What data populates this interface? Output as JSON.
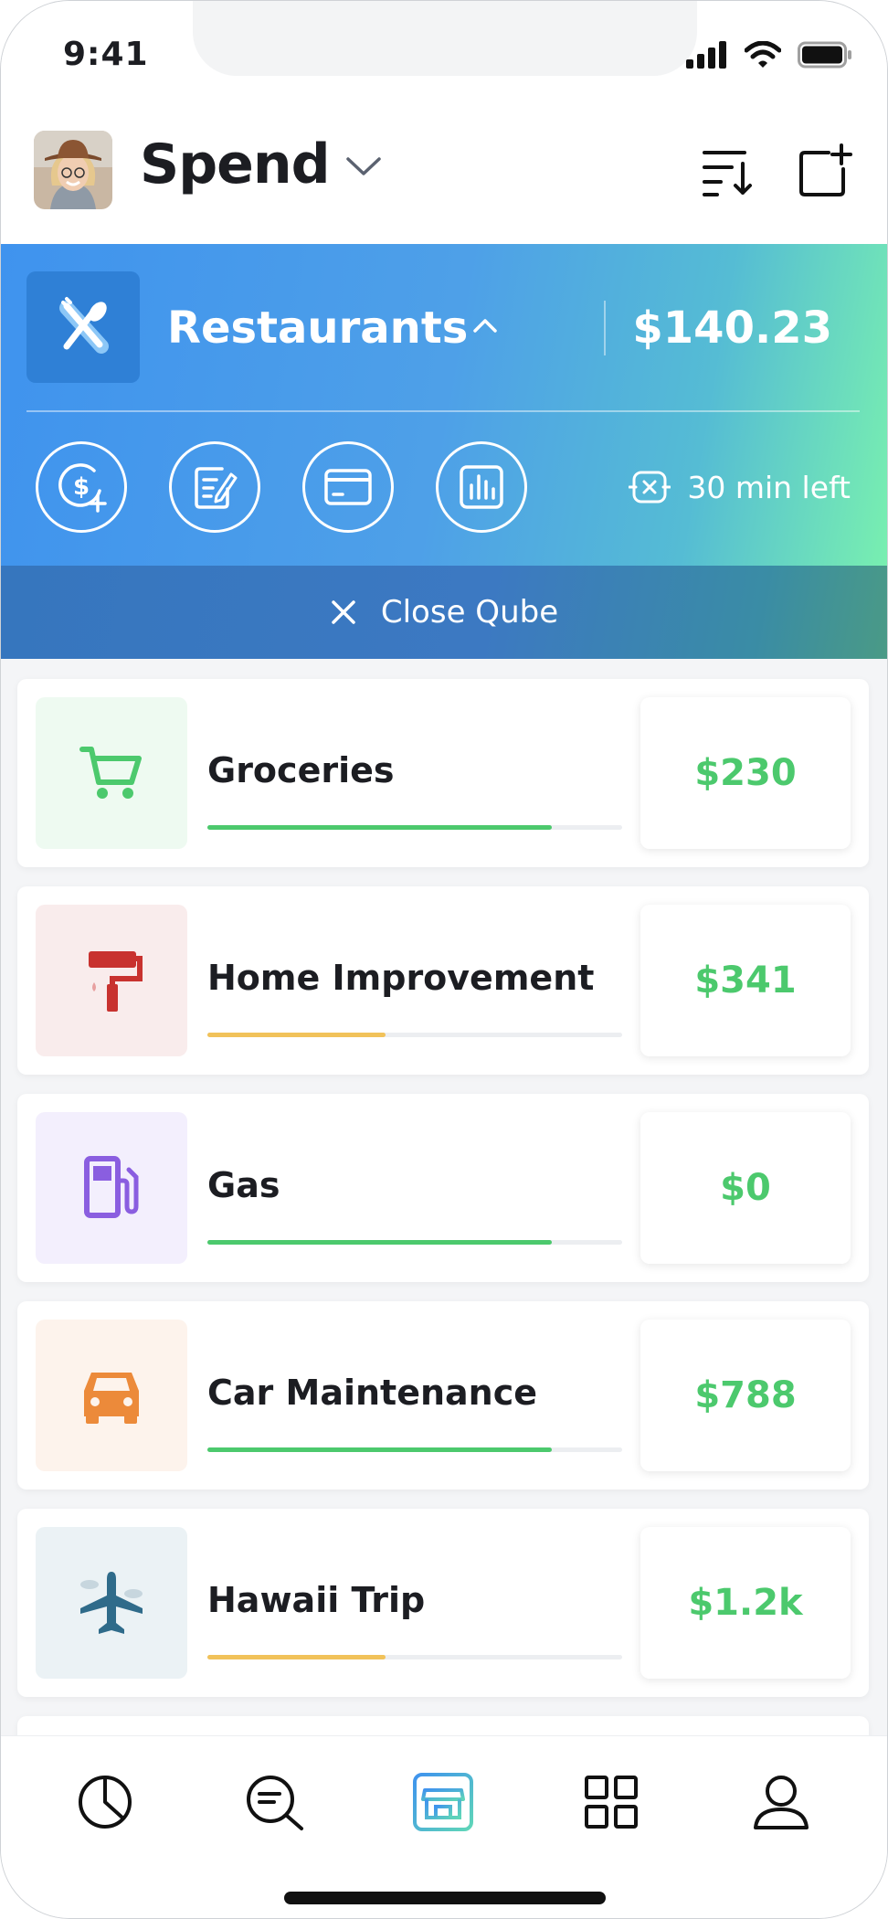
{
  "status_bar": {
    "time": "9:41"
  },
  "header": {
    "title": "Spend"
  },
  "qube": {
    "category": "Restaurants",
    "amount": "$140.23",
    "timer_text": "30 min left",
    "close_label": "Close Qube",
    "actions": [
      "add-funds-icon",
      "notes-icon",
      "card-icon",
      "report-icon"
    ]
  },
  "categories": [
    {
      "name": "Groceries",
      "amount": "$230",
      "progress": 0.83,
      "bar_color": "#4cc96d",
      "icon": "cart-icon",
      "icon_color": "#4cc96d",
      "icon_bg": "#eefaf1"
    },
    {
      "name": "Home Improvement",
      "amount": "$341",
      "progress": 0.43,
      "bar_color": "#f1c25a",
      "icon": "paint-roller-icon",
      "icon_color": "#c8322f",
      "icon_bg": "#f9ecec"
    },
    {
      "name": "Gas",
      "amount": "$0",
      "progress": 0.83,
      "bar_color": "#4cc96d",
      "icon": "gas-pump-icon",
      "icon_color": "#8a5ee0",
      "icon_bg": "#f3effd"
    },
    {
      "name": "Car Maintenance",
      "amount": "$788",
      "progress": 0.83,
      "bar_color": "#4cc96d",
      "icon": "car-icon",
      "icon_color": "#ec8a3a",
      "icon_bg": "#fdf3ec"
    },
    {
      "name": "Hawaii Trip",
      "amount": "$1.2k",
      "progress": 0.43,
      "bar_color": "#f1c25a",
      "icon": "airplane-icon",
      "icon_color": "#2f6b8a",
      "icon_bg": "#ebf2f5"
    }
  ],
  "tabs": [
    "chart-tab-icon",
    "search-tab-icon",
    "store-tab-icon",
    "grid-tab-icon",
    "profile-tab-icon"
  ],
  "colors": {
    "accent_green": "#4cc96d",
    "qube_blue": "#3f93ee",
    "qube_green": "#78efb0"
  }
}
